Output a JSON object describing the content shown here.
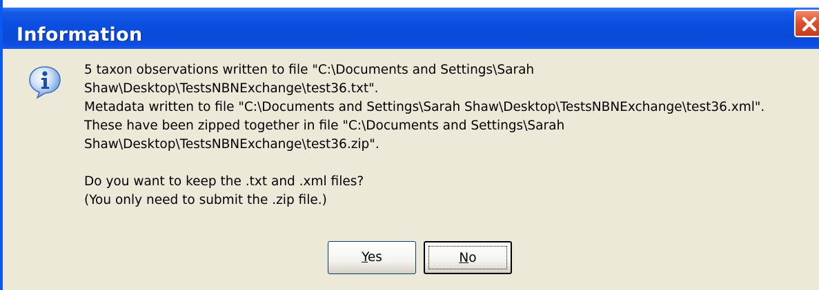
{
  "window": {
    "title": "Information",
    "close_icon": "close-icon",
    "title_bar_color": "#0a4fe0",
    "close_button_color": "#e0502e"
  },
  "dialog": {
    "icon": "info-icon",
    "message_lines": [
      "5 taxon observations written to file \"C:\\Documents and Settings\\Sarah",
      "Shaw\\Desktop\\TestsNBNExchange\\test36.txt\".",
      "Metadata written to file \"C:\\Documents and Settings\\Sarah Shaw\\Desktop\\TestsNBNExchange\\test36.xml\".",
      "These have been zipped together in  file \"C:\\Documents and Settings\\Sarah",
      "Shaw\\Desktop\\TestsNBNExchange\\test36.zip\"."
    ],
    "question_lines": [
      "Do you want to keep the .txt and .xml files?",
      "(You only need to submit the .zip file.)"
    ]
  },
  "buttons": {
    "yes": {
      "accel": "Y",
      "rest": "es"
    },
    "no": {
      "accel": "N",
      "rest": "o"
    }
  }
}
